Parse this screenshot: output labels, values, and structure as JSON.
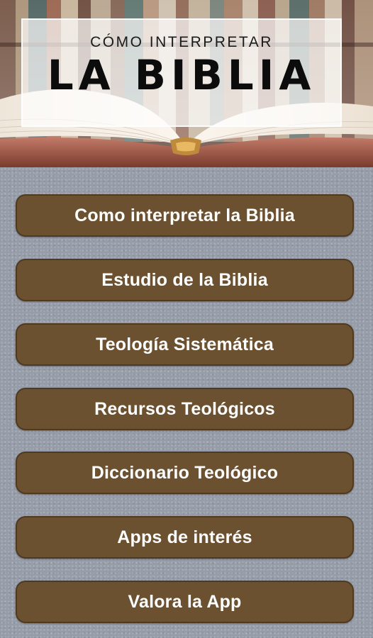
{
  "header": {
    "title_small": "CÓMO INTERPRETAR",
    "title_big": "LA BIBLIA"
  },
  "menu": [
    {
      "label": "Como interpretar la Biblia"
    },
    {
      "label": "Estudio de la Biblia"
    },
    {
      "label": "Teología Sistemática"
    },
    {
      "label": "Recursos Teológicos"
    },
    {
      "label": "Diccionario Teológico"
    },
    {
      "label": "Apps de interés"
    },
    {
      "label": "Valora la App"
    }
  ],
  "colors": {
    "button_fill": "#6b5130",
    "button_text": "#ffffff",
    "background": "#969da9"
  }
}
